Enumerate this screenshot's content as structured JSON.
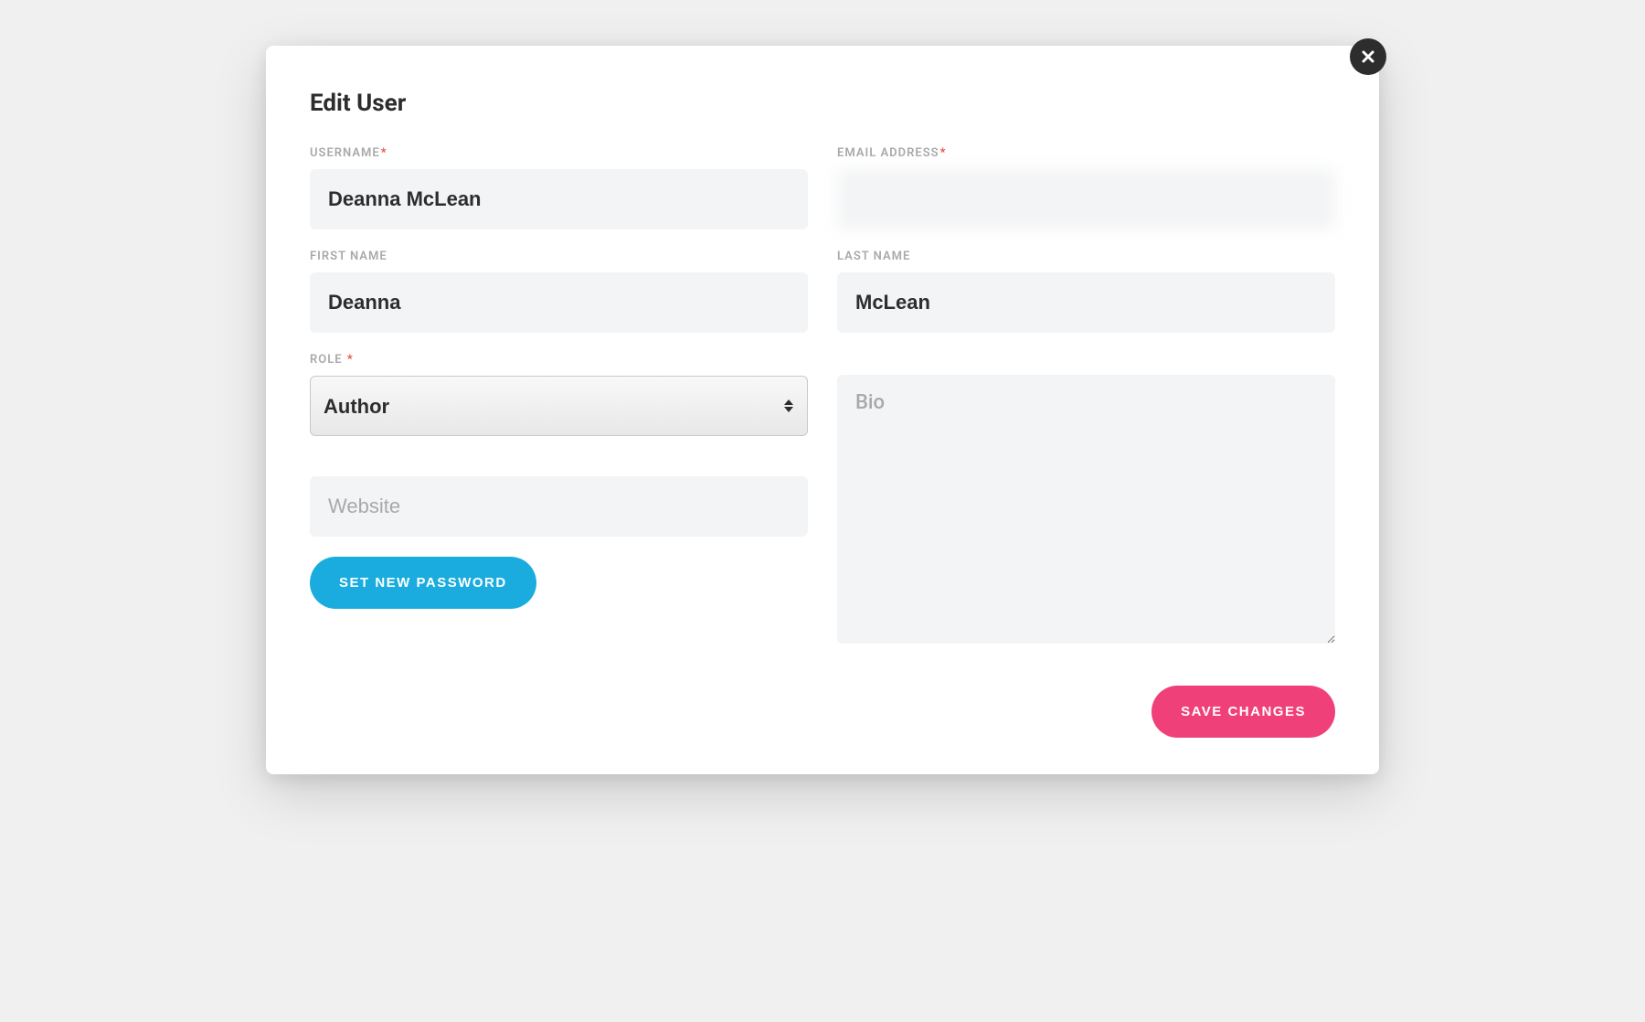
{
  "modal": {
    "title": "Edit User",
    "labels": {
      "username": "USERNAME",
      "email": "EMAIL ADDRESS",
      "firstName": "FIRST NAME",
      "lastName": "LAST NAME",
      "role": "ROLE"
    },
    "values": {
      "username": "Deanna McLean",
      "email": "",
      "firstName": "Deanna",
      "lastName": "McLean",
      "role": "Author",
      "website": "",
      "bio": ""
    },
    "placeholders": {
      "website": "Website",
      "bio": "Bio"
    },
    "buttons": {
      "setPassword": "SET NEW PASSWORD",
      "saveChanges": "SAVE CHANGES"
    },
    "requiredMark": "*"
  }
}
